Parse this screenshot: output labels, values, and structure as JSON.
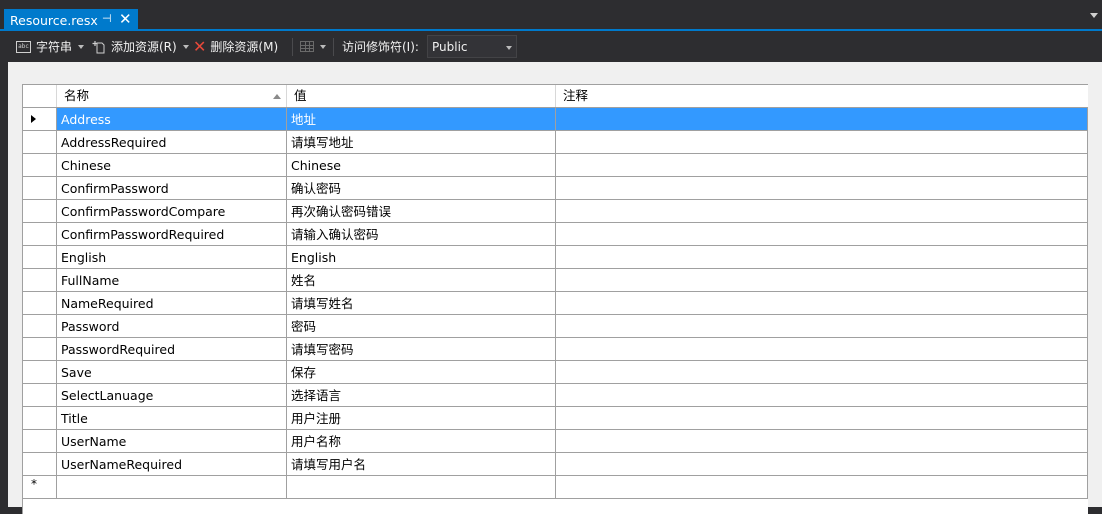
{
  "tab": {
    "title": "Resource.resx",
    "pin": "⊣",
    "close": "✕"
  },
  "toolbar": {
    "strings_label": "字符串",
    "strings_icon": "abc",
    "add_resource_label": "添加资源(R)",
    "delete_resource_label": "删除资源(M)",
    "access_modifier_label": "访问修饰符(I):",
    "access_modifier_value": "Public"
  },
  "grid": {
    "columns": [
      "名称",
      "值",
      "注释"
    ],
    "sorted_column": "名称",
    "selected_row": 0,
    "rows": [
      {
        "name": "Address",
        "value": "地址",
        "comment": ""
      },
      {
        "name": "AddressRequired",
        "value": "请填写地址",
        "comment": ""
      },
      {
        "name": "Chinese",
        "value": "Chinese",
        "comment": ""
      },
      {
        "name": "ConfirmPassword",
        "value": "确认密码",
        "comment": ""
      },
      {
        "name": "ConfirmPasswordCompare",
        "value": "再次确认密码错误",
        "comment": ""
      },
      {
        "name": "ConfirmPasswordRequired",
        "value": "请输入确认密码",
        "comment": ""
      },
      {
        "name": "English",
        "value": "English",
        "comment": ""
      },
      {
        "name": "FullName",
        "value": "姓名",
        "comment": ""
      },
      {
        "name": "NameRequired",
        "value": "请填写姓名",
        "comment": ""
      },
      {
        "name": "Password",
        "value": "密码",
        "comment": ""
      },
      {
        "name": "PasswordRequired",
        "value": "请填写密码",
        "comment": ""
      },
      {
        "name": "Save",
        "value": "保存",
        "comment": ""
      },
      {
        "name": "SelectLanuage",
        "value": "选择语言",
        "comment": ""
      },
      {
        "name": "Title",
        "value": "用户注册",
        "comment": ""
      },
      {
        "name": "UserName",
        "value": "用户名称",
        "comment": ""
      },
      {
        "name": "UserNameRequired",
        "value": "请填写用户名",
        "comment": ""
      }
    ],
    "new_row_marker": "*"
  },
  "colors": {
    "accent": "#007acc",
    "selection": "#3399ff",
    "delete_icon": "#e8493a"
  }
}
